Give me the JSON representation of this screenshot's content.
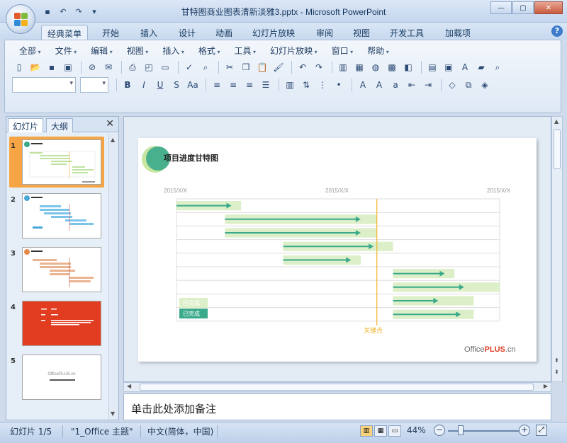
{
  "window": {
    "title": "甘特图商业图表清新淡雅3.pptx - Microsoft PowerPoint",
    "min": "—",
    "max": "▢",
    "close": "✕"
  },
  "tabs": [
    {
      "label": "经典菜单",
      "active": true
    },
    {
      "label": "开始"
    },
    {
      "label": "插入"
    },
    {
      "label": "设计"
    },
    {
      "label": "动画"
    },
    {
      "label": "幻灯片放映"
    },
    {
      "label": "审阅"
    },
    {
      "label": "视图"
    },
    {
      "label": "开发工具"
    },
    {
      "label": "加载项"
    }
  ],
  "menus": [
    "全部",
    "文件",
    "编辑",
    "视图",
    "插入",
    "格式",
    "工具",
    "幻灯片放映",
    "窗口",
    "帮助"
  ],
  "format_buttons": {
    "bold": "B",
    "italic": "I",
    "underline": "U",
    "shadow": "S",
    "case": "Aa"
  },
  "left_pane": {
    "tab_slides": "幻灯片",
    "tab_outline": "大纲",
    "close": "✕",
    "thumbs": [
      {
        "num": "1",
        "selected": true
      },
      {
        "num": "2"
      },
      {
        "num": "3"
      },
      {
        "num": "4"
      },
      {
        "num": "5"
      }
    ],
    "thumb5_text": "OfficePLUS.cn"
  },
  "slide": {
    "title": "项目进度甘特图",
    "date_labels": [
      "2015/X/X",
      "2015/X/X",
      "2015/X/X"
    ],
    "legend_done": "已完成",
    "legend_done2": "已完成",
    "milestone": "关键点",
    "brand_office": "Office",
    "brand_plus": "PLUS",
    "brand_cn": ".cn",
    "colors": {
      "accent": "#3aaa8a",
      "bar_bg": "#dcefc8",
      "milestone": "#f0b429"
    }
  },
  "chart_data": {
    "type": "gantt",
    "rows": 9,
    "tasks": [
      {
        "row": 1,
        "bg": [
          0.0,
          0.2
        ],
        "arrow": [
          0.0,
          0.17
        ]
      },
      {
        "row": 2,
        "bg": [
          0.15,
          0.62
        ],
        "arrow": [
          0.15,
          0.57
        ]
      },
      {
        "row": 3,
        "bg": [
          0.15,
          0.62
        ],
        "arrow": [
          0.15,
          0.57
        ]
      },
      {
        "row": 4,
        "bg": [
          0.33,
          0.67
        ],
        "arrow": [
          0.33,
          0.61
        ]
      },
      {
        "row": 5,
        "bg": [
          0.33,
          0.57
        ],
        "arrow": [
          0.33,
          0.54
        ]
      },
      {
        "row": 6,
        "bg": [
          0.67,
          0.86
        ],
        "arrow": [
          0.67,
          0.83
        ]
      },
      {
        "row": 7,
        "bg": [
          0.67,
          1.0
        ],
        "arrow": [
          0.67,
          0.89
        ]
      },
      {
        "row": 8,
        "bg": [
          0.67,
          0.92
        ],
        "arrow": [
          0.67,
          0.81
        ]
      },
      {
        "row": 9,
        "bg": [
          0.67,
          0.92
        ],
        "arrow": [
          0.67,
          0.88
        ]
      }
    ],
    "milestone_at": 0.62
  },
  "notes_placeholder": "单击此处添加备注",
  "status": {
    "slide": "幻灯片 1/5",
    "theme": "\"1_Office 主题\"",
    "lang": "中文(简体，中国)",
    "zoom": "44%"
  }
}
